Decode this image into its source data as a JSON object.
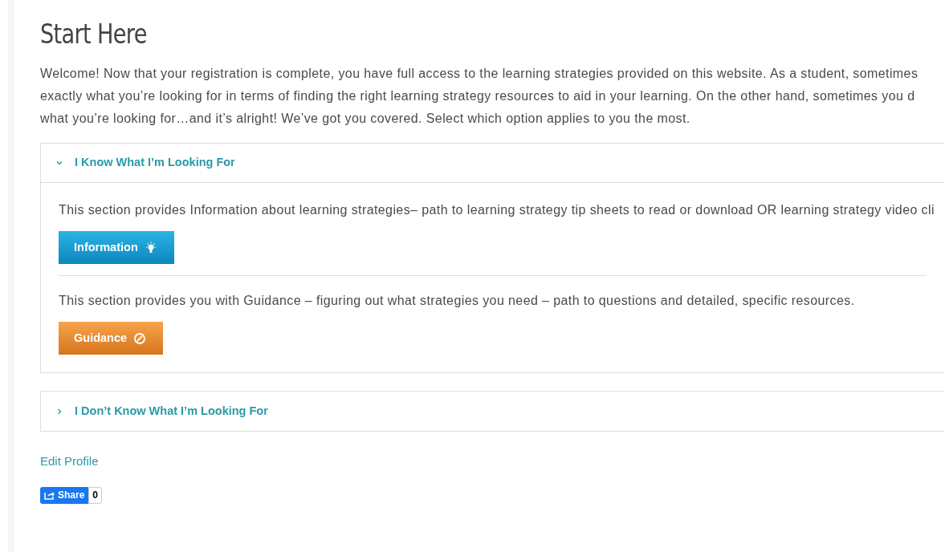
{
  "title": "Start Here",
  "intro_lines": [
    "Welcome! Now that your registration is complete, you have full access to the learning strategies provided on this website.  As a student, sometimes",
    "exactly what you’re looking for in terms of finding the right learning strategy resources to aid in your learning. On the other hand, sometimes you d",
    "what you’re looking for…and it’s alright! We’ve got you covered. Select which option applies to you the most."
  ],
  "accordion": [
    {
      "label": "I Know What I’m Looking For",
      "expanded": true,
      "sections": [
        {
          "text": "This section provides Information about learning strategies– path to learning  strategy tip sheets to read or download OR learning strategy video cli",
          "button": {
            "label": "Information",
            "kind": "info"
          }
        },
        {
          "text": "This section provides you with Guidance – figuring out what strategies you need – path to questions and detailed, specific resources.",
          "button": {
            "label": "Guidance",
            "kind": "guidance"
          }
        }
      ]
    },
    {
      "label": "I Don’t Know What I’m Looking For",
      "expanded": false
    }
  ],
  "edit_profile": "Edit Profile",
  "share": {
    "label": "Share",
    "count": "0"
  }
}
